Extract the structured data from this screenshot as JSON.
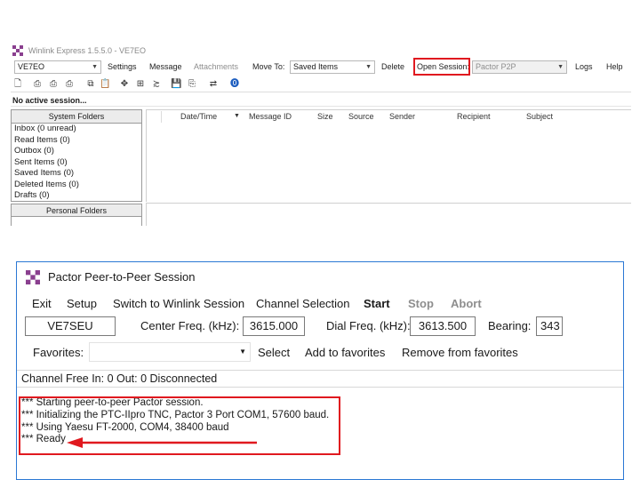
{
  "top_window": {
    "title": "Winlink Express 1.5.5.0 - VE7EO",
    "callsign": "VE7EO",
    "menu": {
      "settings": "Settings",
      "message": "Message",
      "attachments": "Attachments",
      "move_to": "Move To:",
      "move_to_value": "Saved Items",
      "delete": "Delete",
      "open_session": "Open Session:",
      "session_type": "Pactor P2P",
      "logs": "Logs",
      "help": "Help"
    },
    "status": "No active session...",
    "system_folders_header": "System Folders",
    "folders": [
      "Inbox (0 unread)",
      "Read Items (0)",
      "Outbox (0)",
      "Sent Items (0)",
      "Saved Items (0)",
      "Deleted Items (0)",
      "Drafts (0)"
    ],
    "personal_folders_header": "Personal Folders",
    "columns": [
      "Date/Time",
      "Message ID",
      "Size",
      "Source",
      "Sender",
      "Recipient",
      "Subject"
    ],
    "icons": [
      "new-doc-icon",
      "print-icon",
      "print-preview-icon",
      "print-all-icon",
      "copy-icon",
      "paste-icon",
      "move-icon",
      "forward-icon",
      "reply-icon",
      "save-icon",
      "attach-icon",
      "sort-icon",
      "help-icon"
    ]
  },
  "pactor_window": {
    "title": "Pactor Peer-to-Peer Session",
    "menu": {
      "exit": "Exit",
      "setup": "Setup",
      "switch": "Switch to Winlink Session",
      "channel_selection": "Channel Selection",
      "start": "Start",
      "stop": "Stop",
      "abort": "Abort"
    },
    "callsign": "VE7SEU",
    "center_freq_label": "Center Freq. (kHz):",
    "center_freq": "3615.000",
    "dial_freq_label": "Dial Freq. (kHz):",
    "dial_freq": "3613.500",
    "bearing_label": "Bearing:",
    "bearing": "343",
    "favorites_label": "Favorites:",
    "favorites_value": "",
    "select": "Select",
    "add_favorites": "Add to favorites",
    "remove_favorites": "Remove from favorites",
    "status_bar": "Channel Free  In: 0  Out: 0  Disconnected",
    "log": [
      "*** Starting peer-to-peer Pactor session.",
      "*** Initializing the PTC-IIpro TNC,  Pactor 3  Port COM1, 57600 baud.",
      "*** Using Yaesu FT-2000, COM4, 38400 baud",
      "*** Ready"
    ]
  },
  "colors": {
    "highlight_red": "#e0191f",
    "window_border_blue": "#2b78d4"
  }
}
